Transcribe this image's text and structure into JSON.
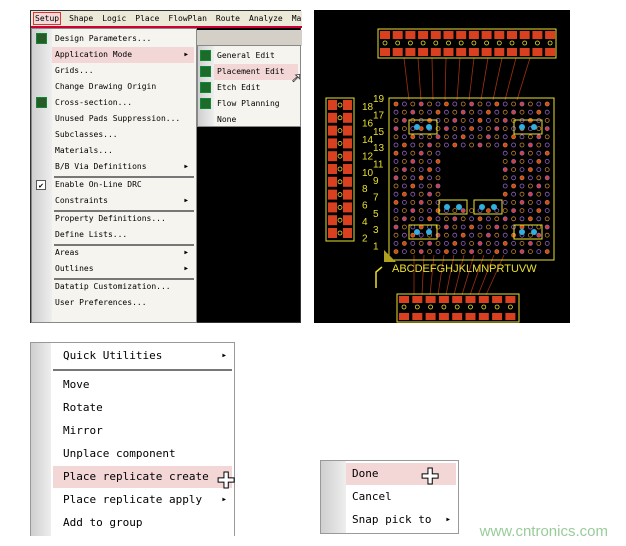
{
  "menubar": [
    "Setup",
    "Shape",
    "Logic",
    "Place",
    "FlowPlan",
    "Route",
    "Analyze",
    "Manu"
  ],
  "setup_menu": [
    {
      "label": "Design Parameters...",
      "icon": "design-parameters-icon"
    },
    {
      "label": "Application Mode",
      "submenu": true,
      "highlighted": true
    },
    {
      "label": "Grids..."
    },
    {
      "label": "Change Drawing Origin"
    },
    {
      "label": "Cross-section...",
      "icon": "cross-section-icon"
    },
    {
      "label": "Unused Pads Suppression..."
    },
    {
      "label": "Subclasses..."
    },
    {
      "label": "Materials..."
    },
    {
      "label": "B/B Via Definitions",
      "submenu": true
    },
    {
      "label": "Enable On-Line DRC",
      "checked": true,
      "sep_before": true
    },
    {
      "label": "Constraints",
      "submenu": true
    },
    {
      "label": "Property Definitions...",
      "sep_before": true
    },
    {
      "label": "Define Lists..."
    },
    {
      "label": "Areas",
      "submenu": true,
      "sep_before": true
    },
    {
      "label": "Outlines",
      "submenu": true
    },
    {
      "label": "Datatip Customization...",
      "sep_before": true
    },
    {
      "label": "User Preferences..."
    }
  ],
  "application_mode_submenu": [
    {
      "label": "General Edit"
    },
    {
      "label": "Placement Edit",
      "highlighted": true
    },
    {
      "label": "Etch Edit"
    },
    {
      "label": "Flow Planning"
    },
    {
      "label": "None"
    }
  ],
  "pcb": {
    "row_labels": [
      "19",
      "18",
      "17",
      "16",
      "15",
      "14",
      "13",
      "12",
      "11",
      "10",
      "9",
      "8",
      "7",
      "6",
      "5",
      "4",
      "3",
      "2",
      "1"
    ],
    "column_labels": "ABCDEFGHJKLMNPRTUVW",
    "colors": {
      "outline": "#e8e030",
      "pad": "#d84020",
      "via": "#9060c0",
      "trace": "#a03010",
      "cap": "#30b0e0"
    }
  },
  "context_menu": [
    {
      "label": "Quick Utilities",
      "submenu": true
    },
    {
      "label": "Move",
      "sep_before": true
    },
    {
      "label": "Rotate"
    },
    {
      "label": "Mirror"
    },
    {
      "label": "Unplace component"
    },
    {
      "label": "Place replicate create",
      "highlighted": true
    },
    {
      "label": "Place replicate apply",
      "submenu": true
    },
    {
      "label": "Add to group"
    }
  ],
  "done_menu": [
    {
      "label": "Done",
      "highlighted": true
    },
    {
      "label": "Cancel"
    },
    {
      "label": "Snap pick to",
      "submenu": true
    }
  ],
  "watermark": "www.cntronics.com",
  "highlight_color": "#f3d6d6"
}
